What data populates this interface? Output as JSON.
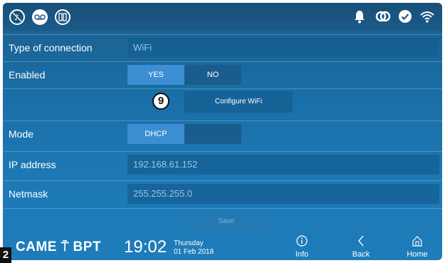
{
  "topbar": {
    "left_icons": [
      "no-music-icon",
      "voicemail-icon",
      "intercom-icon"
    ],
    "right_icons": [
      "bell-icon",
      "link-icon",
      "check-circle-icon",
      "wifi-icon"
    ]
  },
  "settings": {
    "type_of_connection": {
      "label": "Type of connection",
      "value": "WiFi"
    },
    "enabled": {
      "label": "Enabled",
      "yes": "YES",
      "no": "NO",
      "selected": "YES"
    },
    "configure_wifi": {
      "label": "Configure WiFi",
      "badge": "9"
    },
    "mode": {
      "label": "Mode",
      "option": "DHCP"
    },
    "ip_address": {
      "label": "IP address",
      "value": "192.168.61.152"
    },
    "netmask": {
      "label": "Netmask",
      "value": "255.255.255.0"
    },
    "save_label": "Save"
  },
  "bottombar": {
    "brand": {
      "came": "CAME",
      "bpt": "BPT"
    },
    "time": "19:02",
    "day": "Thursday",
    "date": "01 Feb 2018",
    "info_label": "Info",
    "back_label": "Back",
    "home_label": "Home"
  },
  "corner_label": "2",
  "colors": {
    "background": "#1d79b6",
    "active_segment": "#3b8ed2",
    "field": "#145f91"
  }
}
